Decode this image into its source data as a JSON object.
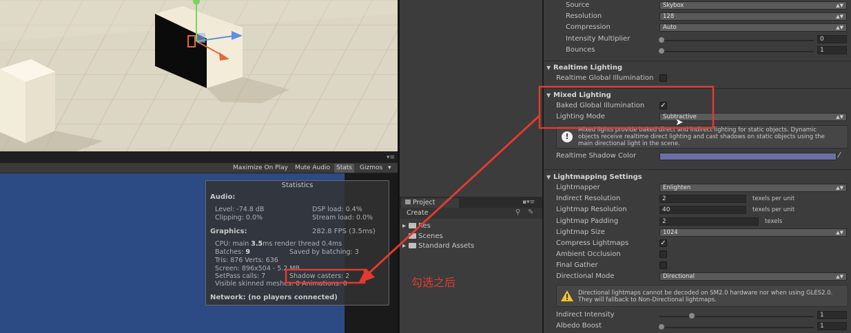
{
  "game_toolbar": {
    "maximize": "Maximize On Play",
    "mute": "Mute Audio",
    "stats": "Stats",
    "gizmos": "Gizmos"
  },
  "stats": {
    "title": "Statistics",
    "audio_hdr": "Audio:",
    "level": "Level: -74.8 dB",
    "dsp": "DSP load: 0.4%",
    "clipping": "Clipping: 0.0%",
    "stream": "Stream load: 0.0%",
    "graphics_hdr": "Graphics:",
    "fps": "282.8 FPS (3.5ms)",
    "cpu_pre": "CPU: main ",
    "cpu_main": "3.5",
    "cpu_post": "ms  render thread 0.4ms",
    "batches_pre": "Batches: ",
    "batches_val": "9",
    "saved": "Saved by batching: 3",
    "tris": "Tris: 876   Verts: 636",
    "screen": "Screen: 896x504 - 5.2 MB",
    "setpass": "SetPass calls: 7",
    "shadow": "Shadow casters: 2",
    "skinned": "Visible skinned meshes: 0   Animations: 0",
    "network": "Network: (no players connected)"
  },
  "project": {
    "tab": "Project",
    "create": "Create",
    "items": [
      "Res",
      "Scenes",
      "Standard Assets"
    ]
  },
  "annotation": "勾选之后",
  "inspector": {
    "source_label": "Source",
    "source_value": "Skybox",
    "resolution_label": "Resolution",
    "resolution_value": "128",
    "compression_label": "Compression",
    "compression_value": "Auto",
    "intensity_label": "Intensity Multiplier",
    "intensity_value": "0",
    "bounces_label": "Bounces",
    "bounces_value": "1",
    "realtime_section": "Realtime Lighting",
    "realtime_gi_label": "Realtime Global Illumination",
    "mixed_section": "Mixed Lighting",
    "baked_gi_label": "Baked Global Illumination",
    "lighting_mode_label": "Lighting Mode",
    "lighting_mode_value": "Subtractive",
    "mixed_help_1": "Mixed lights provide baked direct and indirect lighting for static objects. Dynamic",
    "mixed_help_2": "objects receive realtime direct lighting and cast shadows on static objects using the",
    "mixed_help_3": "main directional light in the scene.",
    "shadow_color_label": "Realtime Shadow Color",
    "lightmapping_section": "Lightmapping Settings",
    "lightmapper_label": "Lightmapper",
    "lightmapper_value": "Enlighten",
    "indirect_res_label": "Indirect Resolution",
    "indirect_res_value": "2",
    "texels_per_unit": "texels per unit",
    "lightmap_res_label": "Lightmap Resolution",
    "lightmap_res_value": "40",
    "padding_label": "Lightmap Padding",
    "padding_value": "2",
    "texels": "texels",
    "size_label": "Lightmap Size",
    "size_value": "1024",
    "compress_label": "Compress Lightmaps",
    "ao_label": "Ambient Occlusion",
    "final_gather_label": "Final Gather",
    "dir_mode_label": "Directional Mode",
    "dir_mode_value": "Directional",
    "dir_help_1": "Directional lightmaps cannot be decoded on SM2.0 hardware nor when using GLES2.0.",
    "dir_help_2": "They will fallback to Non-Directional lightmaps.",
    "indirect_intensity_label": "Indirect Intensity",
    "indirect_intensity_value": "1",
    "albedo_label": "Albedo Boost",
    "albedo_value": "1"
  },
  "states": {
    "realtime_gi": false,
    "baked_gi": true,
    "compress": true,
    "ao": false,
    "final_gather": false,
    "intensity_multiplier": 0.0,
    "bounces": 1,
    "indirect_intensity": 1,
    "albedo_boost": 1
  },
  "colors": {
    "shadow_color": "#6b6fa6",
    "annotation": "#e43a2e",
    "game_bg": "#2c4a84"
  }
}
